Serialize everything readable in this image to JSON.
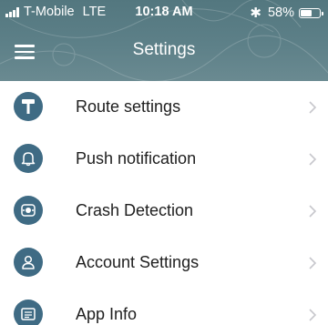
{
  "status_bar": {
    "carrier": "T-Mobile",
    "network": "LTE",
    "time": "10:18 AM",
    "bluetooth_icon": "bluetooth-icon",
    "battery": "58%",
    "battery_level": 0.58
  },
  "header": {
    "title": "Settings",
    "menu_icon": "hamburger-menu-icon"
  },
  "colors": {
    "header": "#5d8088",
    "icon_background": "#3f6b84",
    "chevron": "#c7c7cc"
  },
  "settings_items": [
    {
      "label": "Route settings",
      "icon": "route-sign-icon"
    },
    {
      "label": "Push notification",
      "icon": "bell-icon"
    },
    {
      "label": "Crash Detection",
      "icon": "crash-icon"
    },
    {
      "label": "Account Settings",
      "icon": "user-icon"
    },
    {
      "label": "App Info",
      "icon": "info-card-icon"
    }
  ]
}
